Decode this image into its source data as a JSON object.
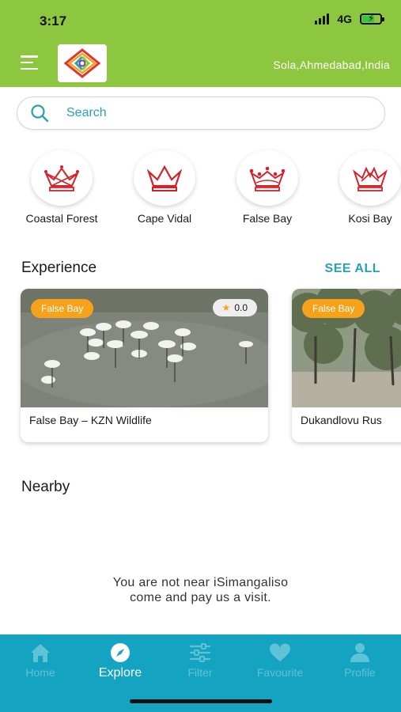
{
  "status": {
    "time": "3:17",
    "network": "4G"
  },
  "header": {
    "location": "Sola,Ahmedabad,India"
  },
  "search": {
    "placeholder": "Search"
  },
  "categories": [
    {
      "label": "Coastal Forest"
    },
    {
      "label": "Cape Vidal"
    },
    {
      "label": "False Bay"
    },
    {
      "label": "Kosi Bay"
    }
  ],
  "experience": {
    "title": "Experience",
    "see_all": "SEE ALL",
    "cards": [
      {
        "tag": "False Bay",
        "rating": "0.0",
        "title": "False Bay – KZN Wildlife"
      },
      {
        "tag": "False Bay",
        "title": "Dukandlovu Rus"
      }
    ]
  },
  "nearby": {
    "title": "Nearby",
    "empty_line1": "You are not near iSimangaliso",
    "empty_line2": "come and pay us a visit."
  },
  "nav": [
    {
      "label": "Home",
      "icon": "home-icon"
    },
    {
      "label": "Explore",
      "icon": "compass-icon",
      "active": true
    },
    {
      "label": "Filter",
      "icon": "sliders-icon"
    },
    {
      "label": "Favourite",
      "icon": "heart-icon"
    },
    {
      "label": "Profile",
      "icon": "user-icon"
    }
  ],
  "colors": {
    "header_green": "#8dc63f",
    "accent_teal": "#2aa0b6",
    "tag_orange": "#f7a21b",
    "crown_red": "#d2232a",
    "nav_bg": "#15a3c2"
  }
}
